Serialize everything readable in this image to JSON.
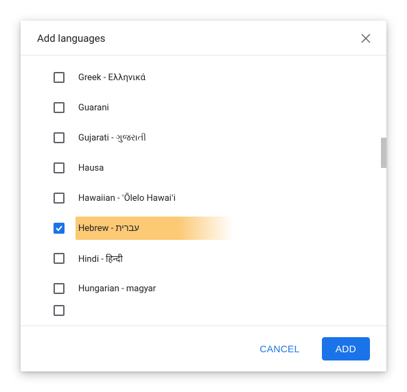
{
  "dialog": {
    "title": "Add languages",
    "languages": [
      {
        "id": "greek",
        "label": "Greek - Ελληνικά",
        "checked": false
      },
      {
        "id": "guarani",
        "label": "Guarani",
        "checked": false
      },
      {
        "id": "gujarati",
        "label": "Gujarati - ગુજરાતી",
        "checked": false
      },
      {
        "id": "hausa",
        "label": "Hausa",
        "checked": false
      },
      {
        "id": "hawaiian",
        "label": "Hawaiian - ʻŌlelo Hawaiʻi",
        "checked": false
      },
      {
        "id": "hebrew",
        "label": "Hebrew - עברית",
        "checked": true,
        "highlighted": true
      },
      {
        "id": "hindi",
        "label": "Hindi - हिन्दी",
        "checked": false
      },
      {
        "id": "hungarian",
        "label": "Hungarian - magyar",
        "checked": false
      }
    ],
    "actions": {
      "cancel": "CANCEL",
      "add": "ADD"
    }
  }
}
